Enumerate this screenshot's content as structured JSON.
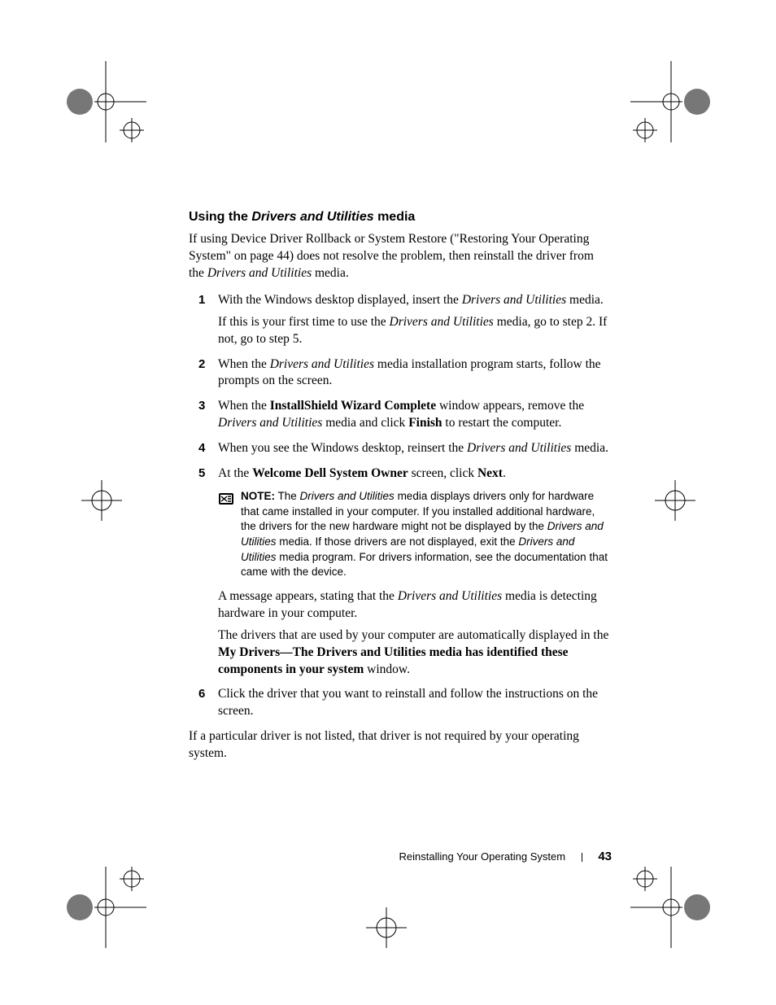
{
  "heading": {
    "prefix": "Using the ",
    "italic": "Drivers and Utilities",
    "suffix": " media"
  },
  "intro": {
    "t1": "If using Device Driver Rollback or System Restore (\"Restoring Your Operating System\" on page 44) does not resolve the problem, then reinstall the driver from the ",
    "i1": "Drivers and Utilities",
    "t2": " media."
  },
  "steps": {
    "s1": {
      "num": "1",
      "a_t1": "With the Windows desktop displayed, insert the ",
      "a_i1": "Drivers and Utilities",
      "a_t2": " media.",
      "b_t1": "If this is your first time to use the ",
      "b_i1": "Drivers and Utilities",
      "b_t2": " media, go to step 2. If not, go to step 5."
    },
    "s2": {
      "num": "2",
      "t1": "When the ",
      "i1": "Drivers and Utilities",
      "t2": " media installation program starts, follow the prompts on the screen."
    },
    "s3": {
      "num": "3",
      "t1": "When the ",
      "b1": "InstallShield Wizard Complete",
      "t2": " window appears, remove the ",
      "i1": "Drivers and Utilities",
      "t3": " media and click ",
      "b2": "Finish",
      "t4": " to restart the computer."
    },
    "s4": {
      "num": "4",
      "t1": "When you see the Windows desktop, reinsert the ",
      "i1": "Drivers and Utilities",
      "t2": " media."
    },
    "s5": {
      "num": "5",
      "t1": "At the ",
      "b1": "Welcome Dell System Owner",
      "t2": " screen, click ",
      "b2": "Next",
      "t3": ".",
      "note": {
        "lead": "NOTE:",
        "t1": " The ",
        "i1": "Drivers and Utilities",
        "t2": " media displays drivers only for hardware that came installed in your computer. If you installed additional hardware, the drivers for the new hardware might not be displayed by the ",
        "i2": "Drivers and Utilities",
        "t3": " media. If those drivers are not displayed, exit the ",
        "i3": "Drivers and Utilities",
        "t4": " media program. For drivers information, see the documentation that came with the device."
      },
      "p2": {
        "t1": "A message appears, stating that the ",
        "i1": "Drivers and Utilities",
        "t2": " media is detecting hardware in your computer."
      },
      "p3": {
        "t1": "The drivers that are used by your computer are automatically displayed in the ",
        "b1": "My Drivers—The Drivers and Utilities media has identified these components in your system",
        "t2": " window."
      }
    },
    "s6": {
      "num": "6",
      "t1": "Click the driver that you want to reinstall and follow the instructions on the screen."
    }
  },
  "closing": "If a particular driver is not listed, that driver is not required by your operating system.",
  "footer": {
    "section": "Reinstalling Your Operating System",
    "page": "43"
  }
}
